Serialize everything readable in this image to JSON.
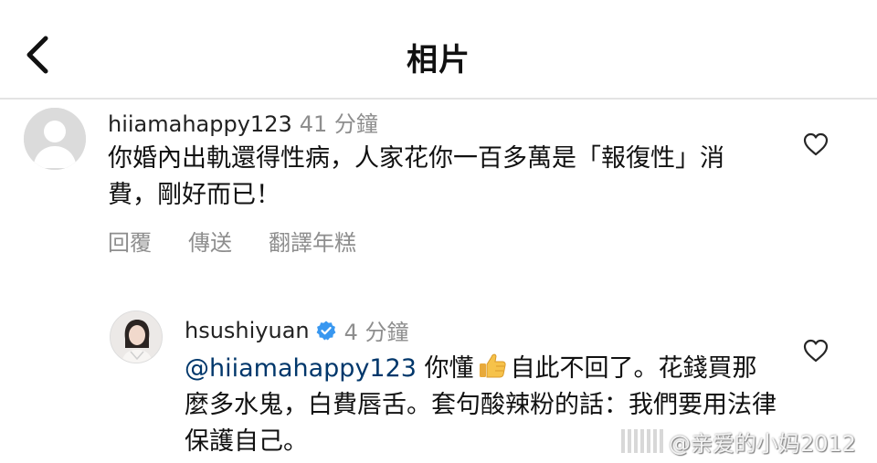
{
  "header": {
    "title": "相片",
    "back_icon": "chevron-left-icon"
  },
  "comment1": {
    "username": "hiiamahappy123",
    "time": "41 分鐘",
    "text": "你婚內出軌還得性病，人家花你一百多萬是「報復性」消費，剛好而已！",
    "actions": {
      "reply": "回覆",
      "send": "傳送",
      "translate": "翻譯年糕"
    }
  },
  "comment2": {
    "username": "hsushiyuan",
    "time": "4 分鐘",
    "verified_icon": "verified-badge-icon",
    "mention": "@hiiamahappy123",
    "text_before_emoji": " 你懂",
    "emoji_icon": "thumbs-up-icon",
    "text_after_emoji": "自此不回了。花錢買那麼多水鬼，白費唇舌。套句酸辣粉的話：我們要用法律保護自己。"
  },
  "icons": {
    "like": "heart-outline-icon"
  },
  "watermark": {
    "text": "@亲爱的小妈2012"
  },
  "colors": {
    "background": "#ffffff",
    "secondary_text": "#8e8e8e",
    "mention": "#00376b",
    "verified": "#3897f0"
  }
}
